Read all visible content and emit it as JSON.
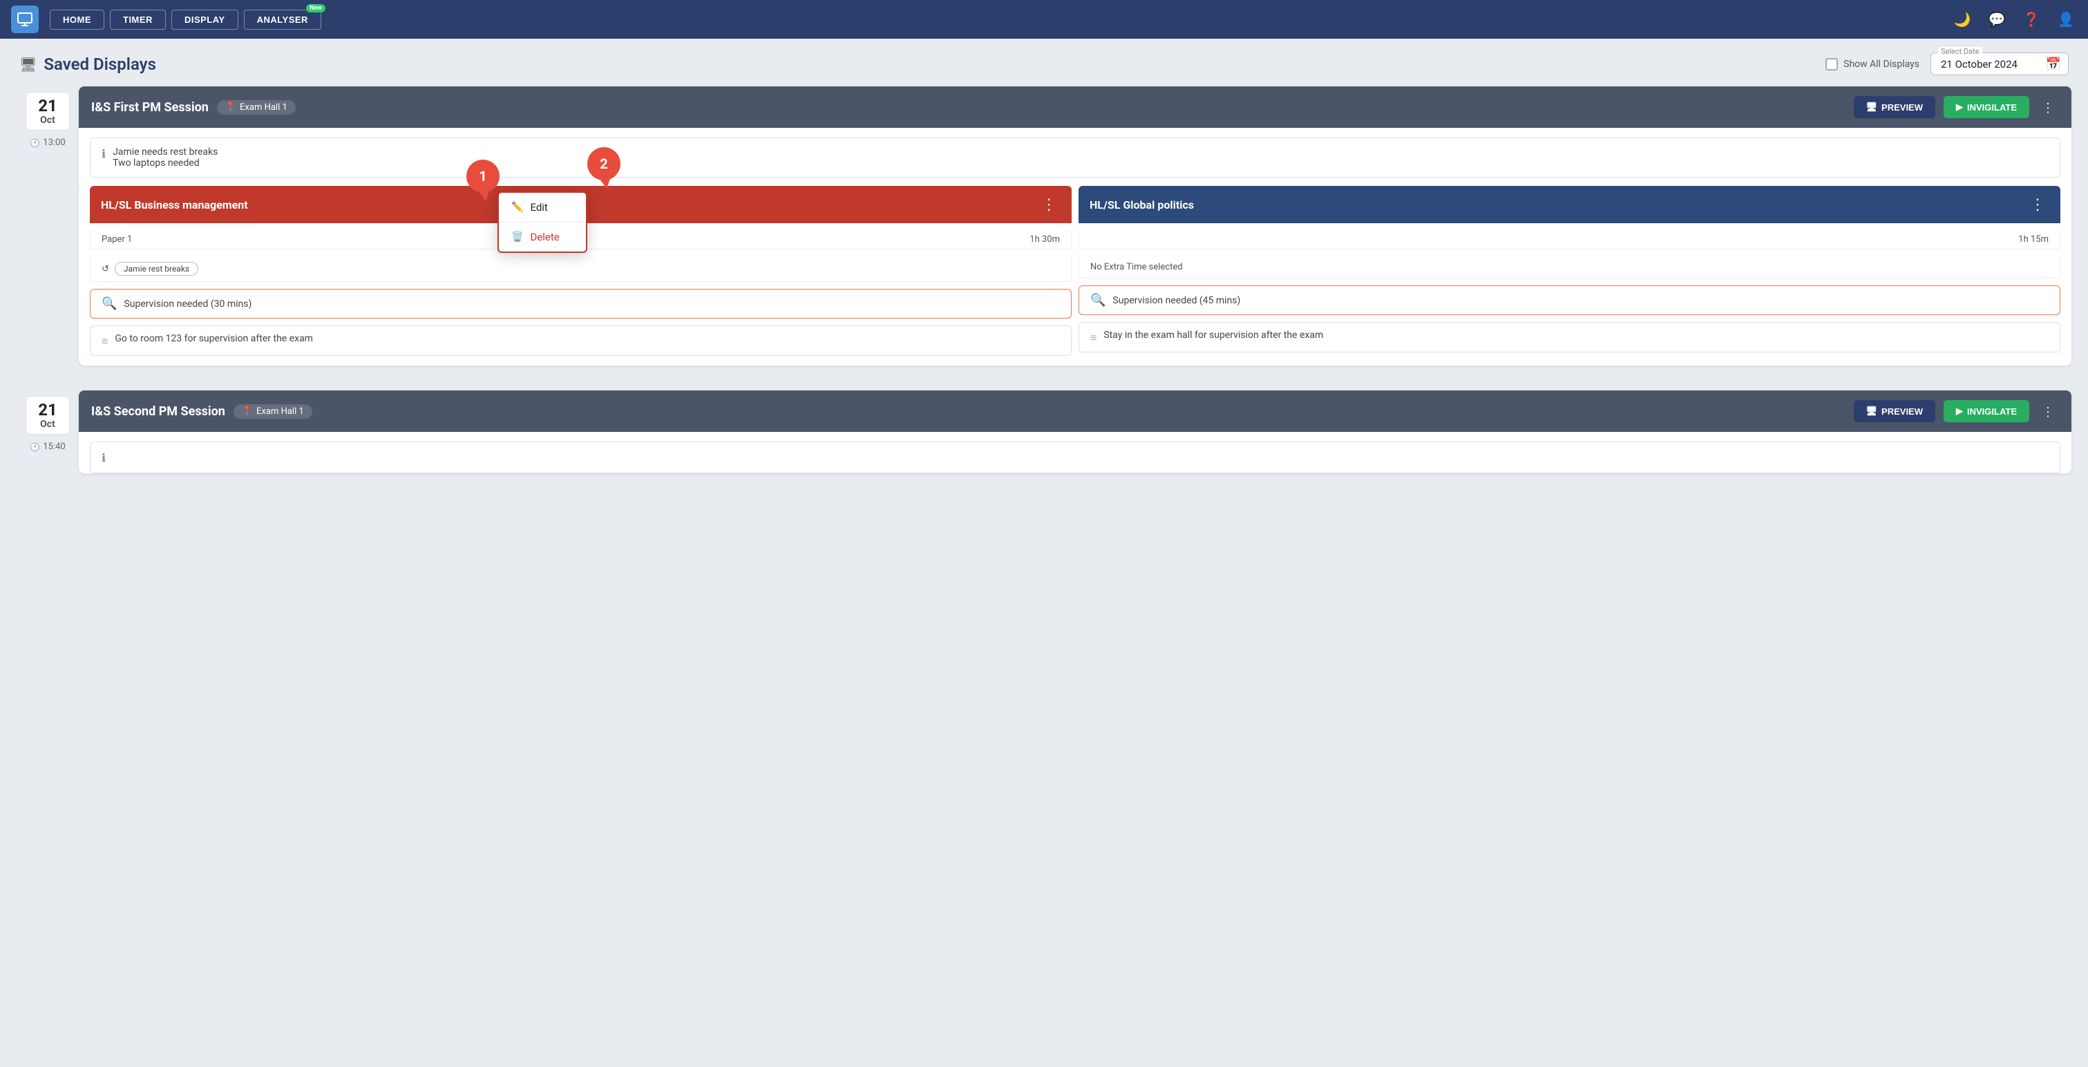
{
  "nav": {
    "logo_label": "Logo",
    "home": "HOME",
    "timer": "TIMER",
    "display": "DISPLAY",
    "analyser": "ANALYSER",
    "new_badge": "New"
  },
  "page": {
    "title": "Saved Displays",
    "show_all_label": "Show All Displays",
    "date_label": "Select Date",
    "date_value": "21 October 2024"
  },
  "sessions": [
    {
      "date_day": "21",
      "date_month": "Oct",
      "time": "13:00",
      "title": "I&S First PM Session",
      "location": "Exam Hall 1",
      "preview_label": "PREVIEW",
      "invigilate_label": "INVIGILATE",
      "info_line1": "Jamie needs rest breaks",
      "info_line2": "Two laptops needed",
      "subjects": [
        {
          "name": "HL/SL Business management",
          "color": "red",
          "paper": "Paper 1",
          "duration": "1h 30m",
          "extra_time_label": "Jamie rest breaks",
          "supervision_label": "Supervision needed (30 mins)",
          "note_label": "Go to room 123 for supervision after the exam"
        },
        {
          "name": "HL/SL Global politics",
          "color": "blue",
          "paper": "",
          "duration": "1h 15m",
          "extra_time_label": "No Extra Time selected",
          "supervision_label": "Supervision needed (45 mins)",
          "note_label": "Stay in the exam hall for supervision after the exam"
        }
      ]
    },
    {
      "date_day": "21",
      "date_month": "Oct",
      "time": "15:40",
      "title": "I&S Second PM Session",
      "location": "Exam Hall 1",
      "preview_label": "PREVIEW",
      "invigilate_label": "INVIGILATE"
    }
  ],
  "context_menu": {
    "edit_label": "Edit",
    "delete_label": "Delete"
  },
  "callouts": {
    "one": "1",
    "two": "2"
  }
}
